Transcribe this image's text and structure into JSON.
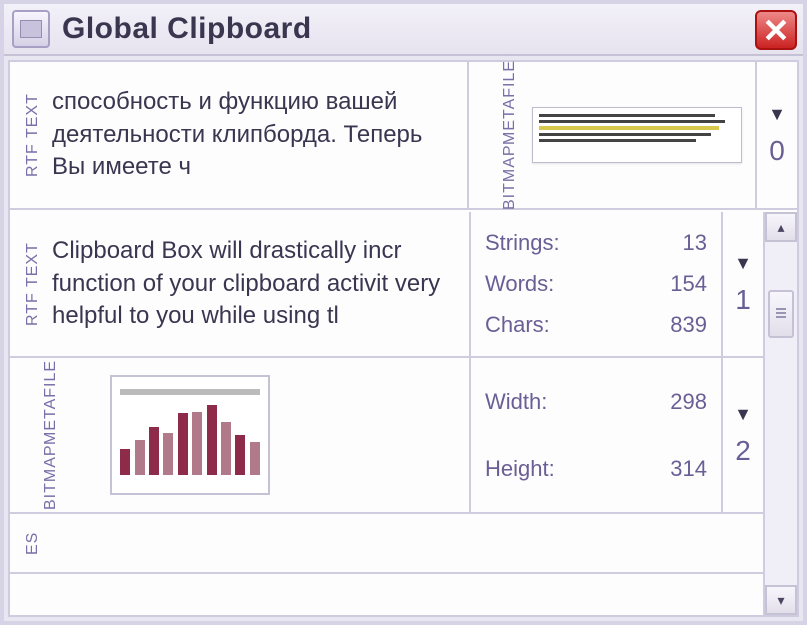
{
  "window": {
    "title": "Global Clipboard"
  },
  "top": {
    "left_label": "RTF TEXT",
    "left_text": "способность и функцию вашей деятельности клипборда. Теперь Вы имеете ч",
    "right_label_a": "BITMAP",
    "right_label_b": "METAFILE",
    "index": "0"
  },
  "items": [
    {
      "label": "RTF TEXT",
      "text": "Clipboard Box will drastically incr function of your clipboard activit very helpful to you while using tl",
      "stats": [
        {
          "k": "Strings:",
          "v": "13"
        },
        {
          "k": "Words:",
          "v": "154"
        },
        {
          "k": "Chars:",
          "v": "839"
        }
      ],
      "index": "1"
    },
    {
      "label_a": "BITMAP",
      "label_b": "METAFILE",
      "stats": [
        {
          "k": "Width:",
          "v": "298"
        },
        {
          "k": "Height:",
          "v": "314"
        }
      ],
      "index": "2"
    },
    {
      "label": "ES"
    }
  ]
}
